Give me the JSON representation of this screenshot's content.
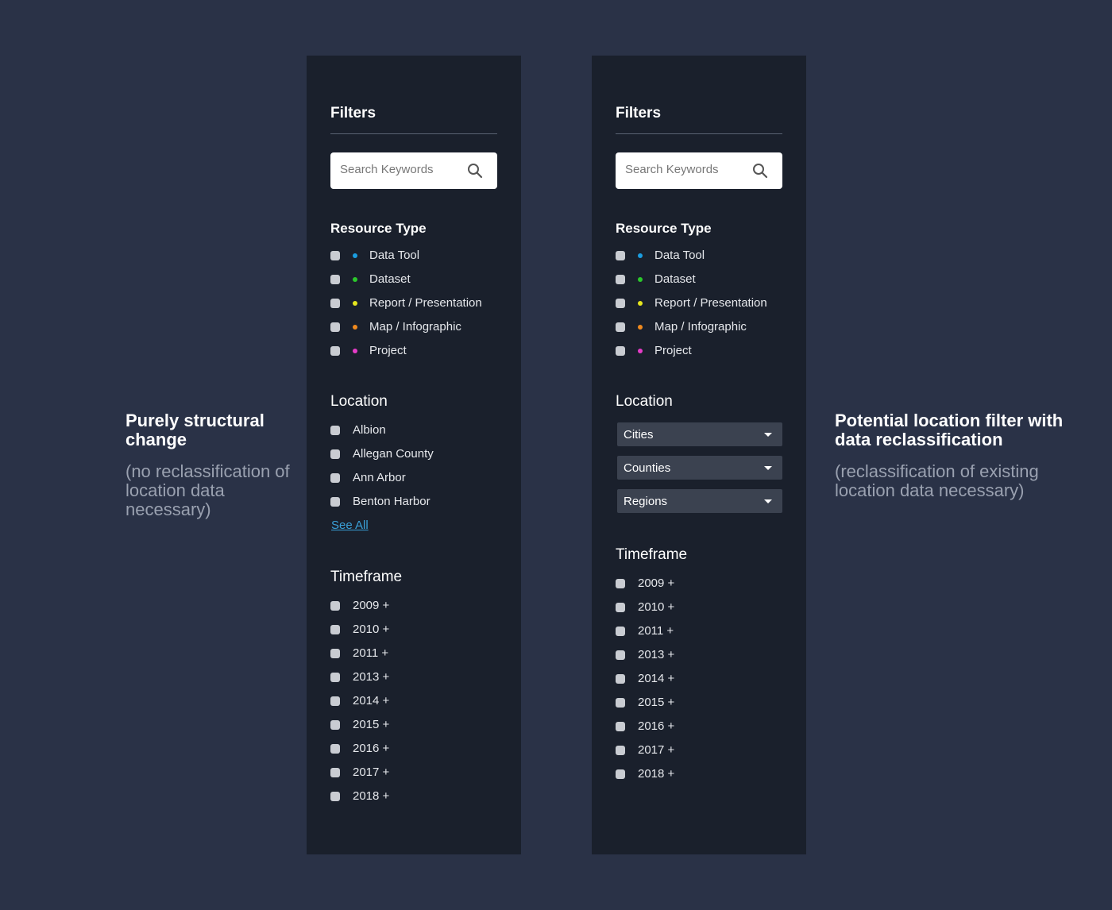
{
  "notes": {
    "left": {
      "title": "Purely structural change",
      "subtitle": "(no reclassification of location data necessary)"
    },
    "right": {
      "title": "Potential location filter with data reclassification",
      "subtitle": "(reclassification of existing location data necessary)"
    }
  },
  "panel_a": {
    "title": "Filters",
    "search_placeholder": "Search Keywords",
    "resource_type": {
      "heading": "Resource Type",
      "items": [
        {
          "label": "Data Tool",
          "color": "#1a9de0"
        },
        {
          "label": "Dataset",
          "color": "#2bc82b"
        },
        {
          "label": "Report / Presentation",
          "color": "#e6e61e"
        },
        {
          "label": "Map / Infographic",
          "color": "#f08a1e"
        },
        {
          "label": "Project",
          "color": "#e63cc8"
        }
      ]
    },
    "location": {
      "heading": "Location",
      "items": [
        "Albion",
        "Allegan County",
        "Ann Arbor",
        "Benton Harbor"
      ],
      "see_all": "See All"
    },
    "timeframe": {
      "heading": "Timeframe",
      "items": [
        "2009 +",
        "2010 +",
        "2011 +",
        "2013 +",
        "2014 +",
        "2015 +",
        "2016 +",
        "2017 +",
        "2018 +"
      ]
    }
  },
  "panel_b": {
    "title": "Filters",
    "search_placeholder": "Search Keywords",
    "resource_type": {
      "heading": "Resource Type",
      "items": [
        {
          "label": "Data Tool",
          "color": "#1a9de0"
        },
        {
          "label": "Dataset",
          "color": "#2bc82b"
        },
        {
          "label": "Report / Presentation",
          "color": "#e6e61e"
        },
        {
          "label": "Map / Infographic",
          "color": "#f08a1e"
        },
        {
          "label": "Project",
          "color": "#e63cc8"
        }
      ]
    },
    "location": {
      "heading": "Location",
      "selects": [
        "Cities",
        "Counties",
        "Regions"
      ]
    },
    "timeframe": {
      "heading": "Timeframe",
      "items": [
        "2009 +",
        "2010 +",
        "2011 +",
        "2013 +",
        "2014 +",
        "2015 +",
        "2016 +",
        "2017 +",
        "2018 +"
      ]
    }
  }
}
